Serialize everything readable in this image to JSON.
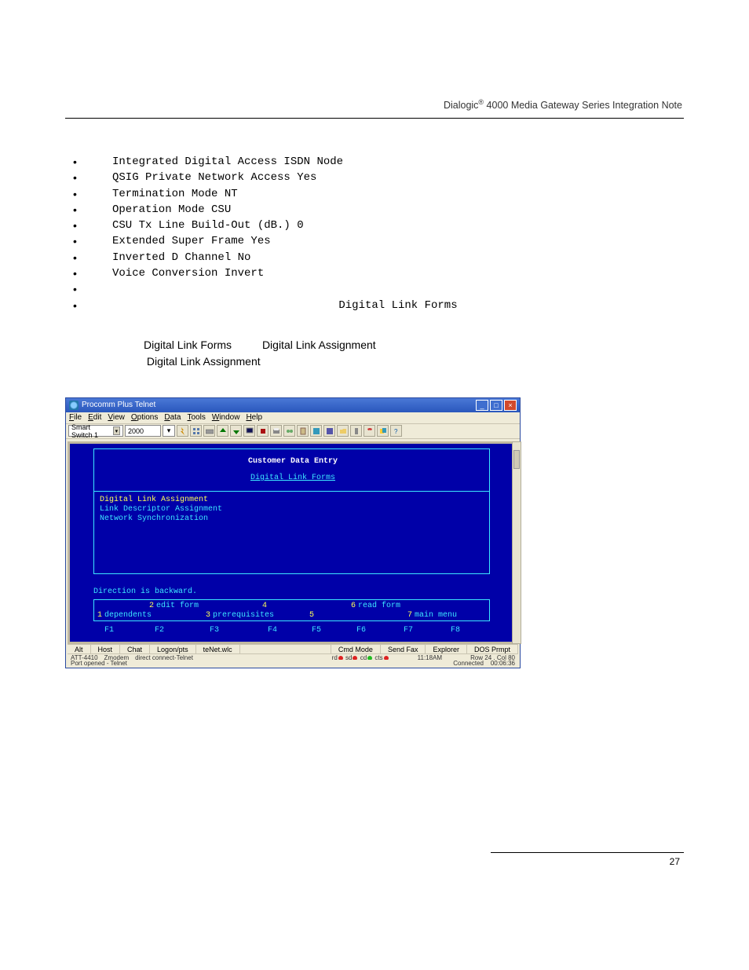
{
  "header": {
    "brand": "Dialogic",
    "suffix": " 4000 Media Gateway Series Integration Note",
    "reg": "®"
  },
  "bullets": {
    "b0": "Integrated Digital Access  ISDN Node",
    "b1": "QSIG Private Network Access  Yes",
    "b2": "Termination Mode  NT",
    "b3": "Operation Mode  CSU",
    "b4": "CSU Tx Line Build-Out (dB.)  0",
    "b5": "Extended Super Frame  Yes",
    "b6": "Inverted D Channel  No",
    "b7": "Voice Conversion  Invert",
    "center": "Digital Link Forms"
  },
  "paragraph": {
    "pre1": "Digital Link Forms",
    "mid1": "Digital Link Assignment",
    "line2": "Digital Link Assignment"
  },
  "window": {
    "title": "Procomm Plus Telnet",
    "menus": {
      "file": "File",
      "edit": "Edit",
      "view": "View",
      "options": "Options",
      "data": "Data",
      "tools": "Tools",
      "window": "Window",
      "help": "Help"
    },
    "combo1": "Smart Switch 1",
    "combo2": "2000",
    "terminal": {
      "title": "Customer Data Entry",
      "subtitle": "Digital Link Forms",
      "menu0": "Digital Link Assignment",
      "menu1": "Link Descriptor Assignment",
      "menu2": "Network Synchronization",
      "msg": "Direction is backward.",
      "fn2_label": "edit form",
      "fn1_label": "dependents",
      "fn3_label": "prerequisites",
      "fn6_label": "read form",
      "fn7_label": "main menu",
      "F1": "F1",
      "F2": "F2",
      "F3": "F3",
      "F4": "F4",
      "F5": "F5",
      "F6": "F6",
      "F7": "F7",
      "F8": "F8",
      "n1": "1",
      "n2": "2",
      "n3": "3",
      "n4": "4",
      "n5": "5",
      "n6": "6",
      "n7": "7"
    },
    "tabs": {
      "t0": "Alt",
      "t1": "Host",
      "t2": "Chat",
      "t3": "Logon/pts",
      "t4": "teNet.wlc",
      "t5": "Cmd Mode",
      "t6": "Send Fax",
      "t7": "Explorer",
      "t8": "DOS Prmpt"
    },
    "status1": {
      "s0": "ATT-4410",
      "s1": "Zmodem",
      "s2": "direct connect-Telnet",
      "leds_label_rd": "rd",
      "leds_label_sd": "sd",
      "leds_label_cd": "cd",
      "leds_label_cts": "cts",
      "time": "11:18AM",
      "rowcol": "Row 24 , Col 80"
    },
    "status2": {
      "left": "Port opened - Telnet",
      "conn": "Connected",
      "dur": "00:06:36"
    }
  },
  "footer": {
    "page": "27"
  }
}
